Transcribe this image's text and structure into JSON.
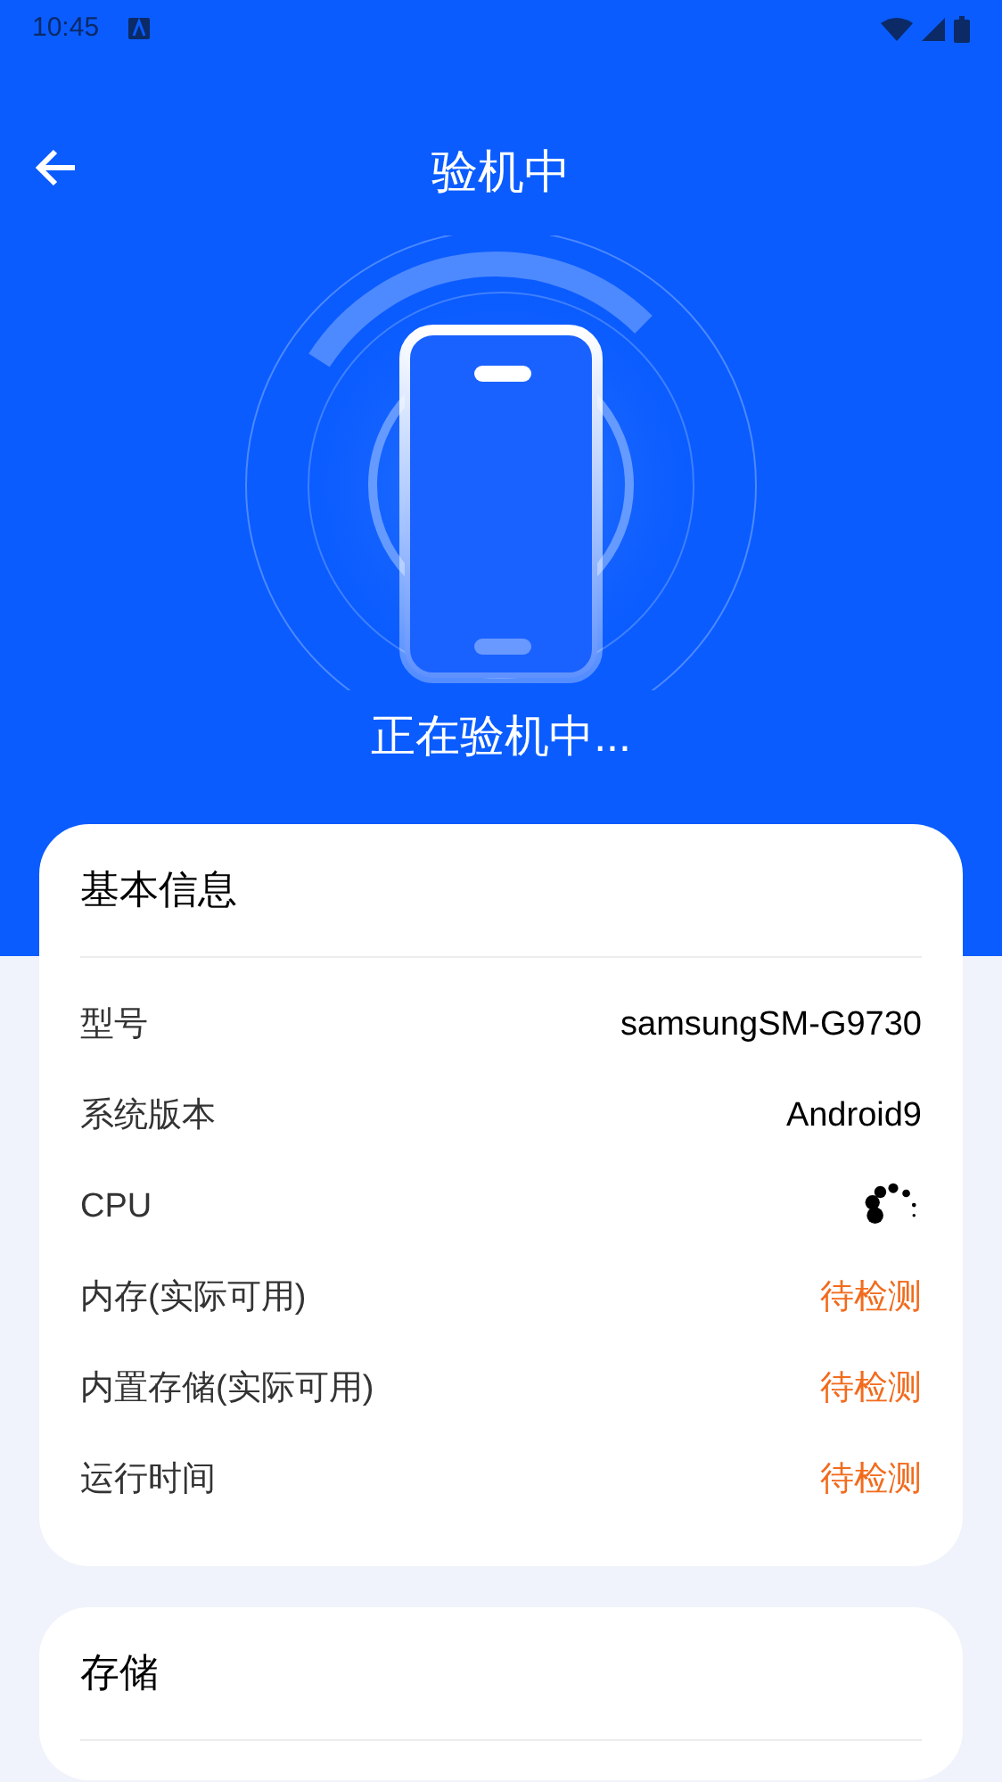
{
  "status_bar": {
    "time": "10:45"
  },
  "header": {
    "title": "验机中"
  },
  "hero": {
    "caption": "正在验机中..."
  },
  "cards": [
    {
      "title": "基本信息",
      "rows": [
        {
          "label": "型号",
          "kind": "text",
          "value": "samsungSM-G9730"
        },
        {
          "label": "系统版本",
          "kind": "text",
          "value": "Android9"
        },
        {
          "label": "CPU",
          "kind": "loading"
        },
        {
          "label": "内存(实际可用)",
          "kind": "pending",
          "value": "待检测"
        },
        {
          "label": "内置存储(实际可用)",
          "kind": "pending",
          "value": "待检测"
        },
        {
          "label": "运行时间",
          "kind": "pending",
          "value": "待检测"
        }
      ]
    },
    {
      "title": "存储"
    }
  ]
}
